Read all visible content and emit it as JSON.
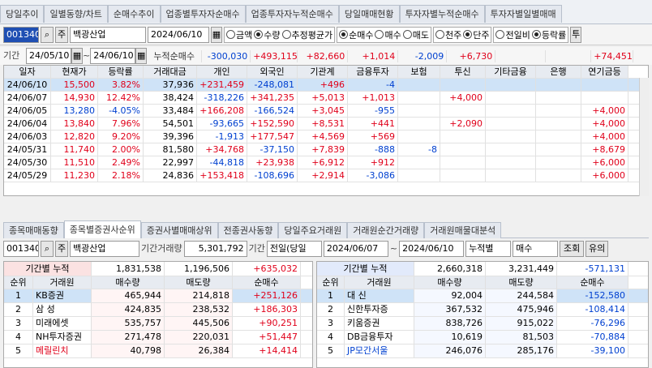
{
  "top_tabs": [
    "당일추이",
    "일별동향/차트",
    "순매수추이",
    "업종별투자자순매수",
    "업종투자자누적순매수",
    "당일매매현황",
    "투자자별누적순매수",
    "투자자별일별매매"
  ],
  "toolbar": {
    "code": "001340",
    "search_icon": "search-icon",
    "tag": "주",
    "name": "백광산업",
    "date": "2024/06/10",
    "r_amount": "금액",
    "r_qty": "수량",
    "r_avg": "추정평균가",
    "r_net": "순매수",
    "r_buy": "매수",
    "r_sell": "매도",
    "r_1000": "천주",
    "r_unit": "단주",
    "r_prev": "전일비",
    "r_rate": "등락률",
    "trail": "투"
  },
  "filter": {
    "label": "기간",
    "from": "24/05/10",
    "to": "24/06/10",
    "sep": "~",
    "sum_label": "누적순매수",
    "sums": [
      "-300,030",
      "+493,115",
      "+82,660",
      "+1,014",
      "-2,009",
      "+6,730",
      "",
      "",
      "+74,451"
    ]
  },
  "grid1": {
    "headers": [
      "일자",
      "현재가",
      "등락률",
      "거래대금",
      "개인",
      "외국인",
      "기관계",
      "금융투자",
      "보험",
      "투신",
      "기타금융",
      "은행",
      "연기금등"
    ],
    "rows": [
      [
        "24/06/10",
        "15,500",
        "3.82%",
        "37,936",
        "+231,459",
        "-248,081",
        "+496",
        "-4",
        "",
        "",
        "",
        "",
        ""
      ],
      [
        "24/06/07",
        "14,930",
        "12.42%",
        "38,424",
        "-318,226",
        "+341,235",
        "+5,013",
        "+1,013",
        "",
        "+4,000",
        "",
        "",
        ""
      ],
      [
        "24/06/05",
        "13,280",
        "-4.05%",
        "33,484",
        "+166,208",
        "-166,524",
        "+3,045",
        "-955",
        "",
        "",
        "",
        "",
        "+4,000"
      ],
      [
        "24/06/04",
        "13,840",
        "7.96%",
        "54,501",
        "-93,665",
        "+152,590",
        "+8,531",
        "+441",
        "",
        "+2,090",
        "",
        "",
        "+4,000"
      ],
      [
        "24/06/03",
        "12,820",
        "9.20%",
        "39,396",
        "-1,913",
        "+177,547",
        "+4,569",
        "+569",
        "",
        "",
        "",
        "",
        "+4,000"
      ],
      [
        "24/05/31",
        "11,740",
        "2.00%",
        "81,580",
        "+34,768",
        "-37,150",
        "+7,839",
        "-888",
        "-8",
        "",
        "",
        "",
        "+8,679"
      ],
      [
        "24/05/30",
        "11,510",
        "2.49%",
        "22,997",
        "-44,818",
        "+23,938",
        "+6,912",
        "+912",
        "",
        "",
        "",
        "",
        "+6,000"
      ],
      [
        "24/05/29",
        "11,230",
        "2.18%",
        "24,836",
        "+153,418",
        "-108,696",
        "+2,914",
        "-3,086",
        "",
        "",
        "",
        "",
        "+6,000"
      ]
    ]
  },
  "bottom_tabs": [
    "종목매매동향",
    "종목별증권사순위",
    "증권사별매매상위",
    "전종권사동향",
    "당일주요거래원",
    "거래원순간거래량",
    "거래원매물대분석"
  ],
  "toolbar2": {
    "code": "001340",
    "tag": "주",
    "name": "백광산업",
    "vol_label": "기간거래량",
    "vol": "5,301,792",
    "period_label": "기간",
    "period_sel": "전일(당일",
    "from": "2024/06/07",
    "sep": "~",
    "to": "2024/06/10",
    "mode": "누적별",
    "side": "매수",
    "btn_query": "조회",
    "btn_note": "유의"
  },
  "left": {
    "sum_label": "기간별 누적",
    "sums": [
      "1,831,538",
      "1,196,506",
      "+635,032"
    ],
    "headers": [
      "순위",
      "거래원",
      "매수량",
      "매도량",
      "순매수"
    ],
    "rows": [
      [
        "1",
        "KB증권",
        "465,944",
        "214,818",
        "+251,126"
      ],
      [
        "2",
        "삼 성",
        "424,835",
        "238,532",
        "+186,303"
      ],
      [
        "3",
        "미래에셋",
        "535,757",
        "445,506",
        "+90,251"
      ],
      [
        "4",
        "NH투자증권",
        "271,478",
        "220,031",
        "+51,447"
      ],
      [
        "5",
        "메릴린치",
        "40,798",
        "26,384",
        "+14,414"
      ]
    ]
  },
  "right": {
    "sum_label": "기간별 누적",
    "sums": [
      "2,660,318",
      "3,231,449",
      "-571,131"
    ],
    "headers": [
      "순위",
      "거래원",
      "매수량",
      "매도량",
      "순매수"
    ],
    "rows": [
      [
        "1",
        "대 신",
        "92,004",
        "244,584",
        "-152,580"
      ],
      [
        "2",
        "신한투자증",
        "367,532",
        "475,946",
        "-108,414"
      ],
      [
        "3",
        "키움증권",
        "838,726",
        "915,022",
        "-76,296"
      ],
      [
        "4",
        "DB금융투자",
        "10,619",
        "81,503",
        "-70,884"
      ],
      [
        "5",
        "JP모간서울",
        "246,076",
        "285,176",
        "-39,100"
      ]
    ]
  }
}
